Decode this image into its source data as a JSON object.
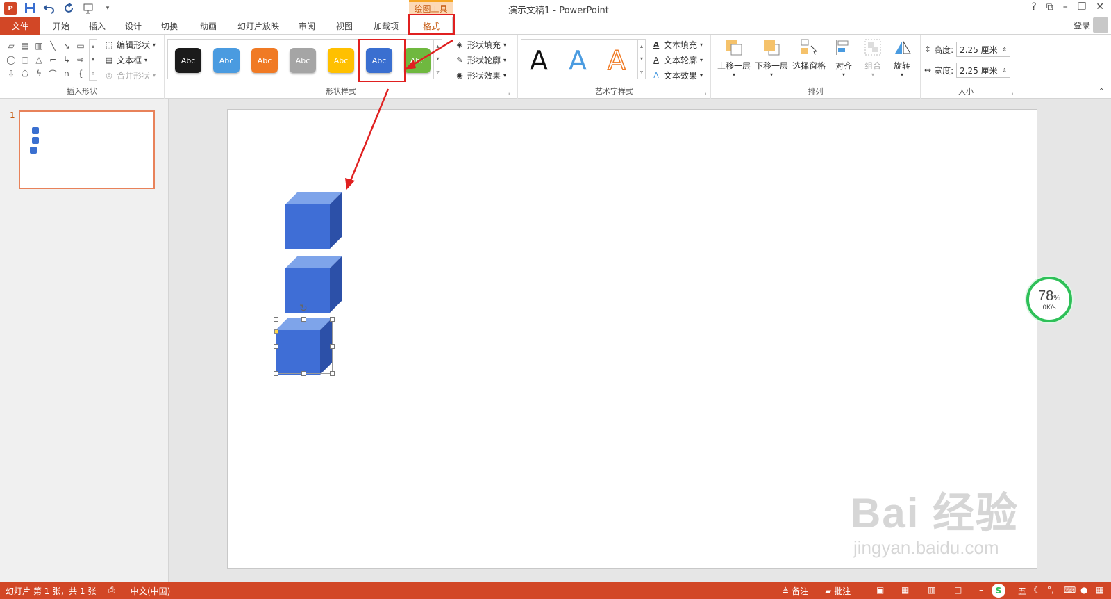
{
  "titlebar": {
    "app_icon": "P",
    "doc_title": "演示文稿1 - PowerPoint",
    "context_group": "绘图工具",
    "help": "?",
    "window_buttons": [
      "ribbon-display-icon",
      "minimize-icon",
      "restore-icon",
      "close-icon"
    ]
  },
  "tabs": {
    "file": "文件",
    "items": [
      "开始",
      "插入",
      "设计",
      "切换",
      "动画",
      "幻灯片放映",
      "审阅",
      "视图",
      "加载项"
    ],
    "active": "格式",
    "login": "登录"
  },
  "ribbon": {
    "insert_shapes": {
      "label": "插入形状",
      "edit_shape": "编辑形状",
      "text_box": "文本框",
      "merge_shapes": "合并形状"
    },
    "shape_styles": {
      "label": "形状样式",
      "swatch_text": "Abc",
      "swatch_colors": [
        "#1b1b1b",
        "#4a9be0",
        "#f07a24",
        "#a5a5a5",
        "#ffc000",
        "#3a6fd0",
        "#6fb83f"
      ],
      "fill": "形状填充",
      "outline": "形状轮廓",
      "effects": "形状效果"
    },
    "wordart_styles": {
      "label": "艺术字样式",
      "sample": "A",
      "text_fill": "文本填充",
      "text_outline": "文本轮廓",
      "text_effects": "文本效果"
    },
    "arrange": {
      "label": "排列",
      "bring_forward": "上移一层",
      "send_backward": "下移一层",
      "selection_pane": "选择窗格",
      "align": "对齐",
      "group": "组合",
      "rotate": "旋转"
    },
    "size": {
      "label": "大小",
      "height_label": "高度:",
      "height_value": "2.25 厘米",
      "width_label": "宽度:",
      "width_value": "2.25 厘米"
    }
  },
  "thumbnails": {
    "slide_number": "1"
  },
  "net_widget": {
    "percent": "78",
    "percent_sign": "%",
    "speed": "0K/s"
  },
  "watermark": {
    "line1": "Bai 经验",
    "line2": "jingyan.baidu.com"
  },
  "statusbar": {
    "slide_info": "幻灯片 第 1 张，共 1 张",
    "language": "中文(中国)",
    "notes": "备注",
    "comments": "批注",
    "ime": "五"
  },
  "colors": {
    "accent": "#d24726",
    "highlight": "#e02020",
    "cube_face": "#3a6fd0",
    "context_tab_text": "#c55a11"
  }
}
